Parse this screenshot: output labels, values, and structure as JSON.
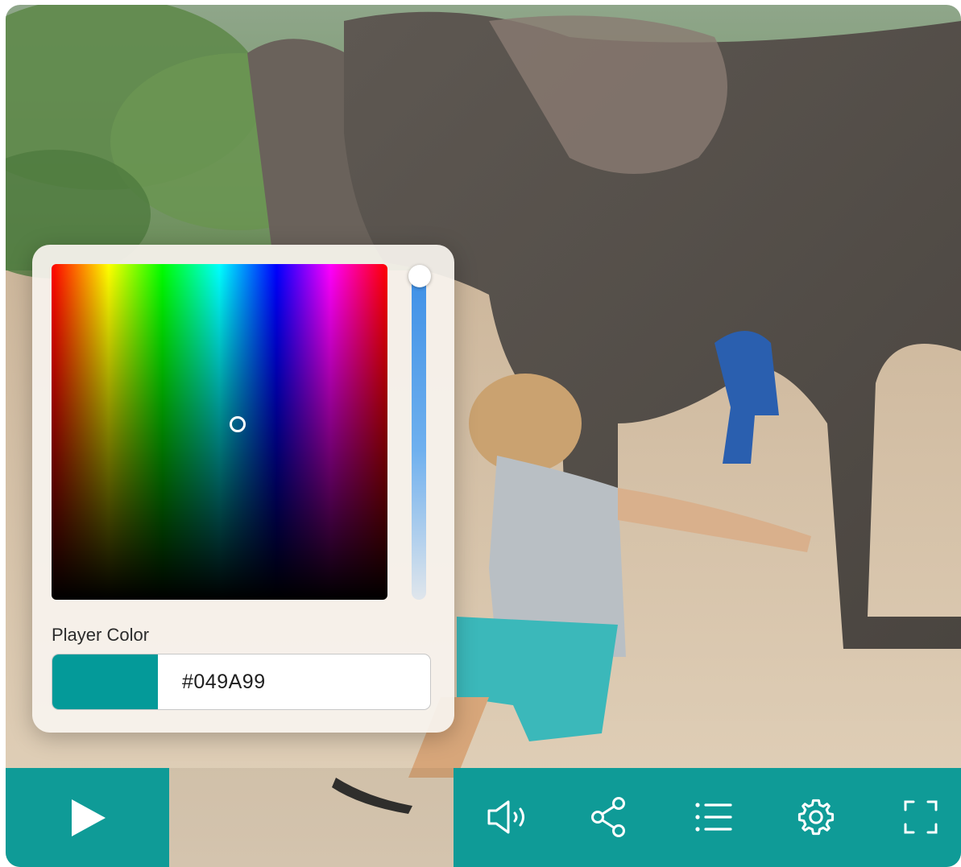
{
  "picker": {
    "label": "Player Color",
    "hex_value": "#049A99",
    "swatch_color": "#049A99"
  },
  "controls": {
    "play": "play-icon",
    "volume": "volume-icon",
    "share": "share-icon",
    "playlist": "list-icon",
    "settings": "gear-icon",
    "fullscreen": "fullscreen-icon"
  },
  "colors": {
    "accent": "#0F9B97",
    "icon": "#FFFFFF"
  }
}
